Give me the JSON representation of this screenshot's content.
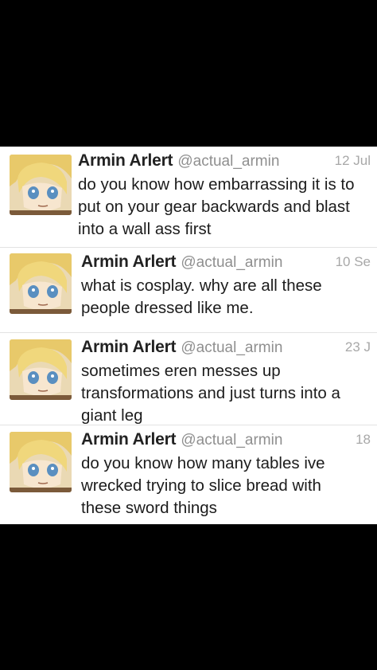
{
  "tweets": [
    {
      "name": "Armin Arlert",
      "handle": "@actual_armin",
      "time": "12 Jul",
      "text": "do you know how embarrassing it is to\nput on your gear backwards and blast\ninto a wall ass first"
    },
    {
      "name": "Armin Arlert",
      "handle": "@actual_armin",
      "time": "10 Se",
      "text": "what is cosplay. why are all these\npeople dressed like me."
    },
    {
      "name": "Armin Arlert",
      "handle": "@actual_armin",
      "time": "23 J",
      "text": "sometimes eren messes up\ntransformations and just turns into a\ngiant leg"
    },
    {
      "name": "Armin Arlert",
      "handle": "@actual_armin",
      "time": "18",
      "text": "do you know how many tables ive\nwrecked trying to slice bread with\nthese sword things"
    }
  ]
}
